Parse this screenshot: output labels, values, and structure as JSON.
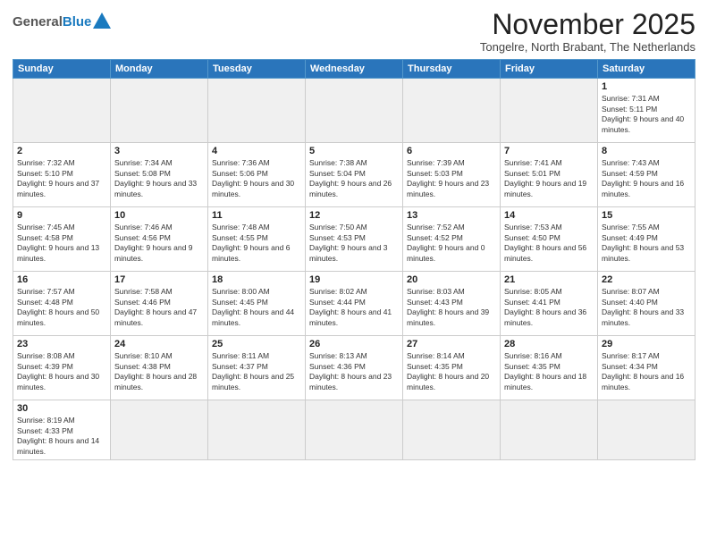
{
  "header": {
    "logo": {
      "general": "General",
      "blue": "Blue"
    },
    "month_year": "November 2025",
    "location": "Tongelre, North Brabant, The Netherlands"
  },
  "weekdays": [
    "Sunday",
    "Monday",
    "Tuesday",
    "Wednesday",
    "Thursday",
    "Friday",
    "Saturday"
  ],
  "weeks": [
    [
      {
        "day": "",
        "empty": true
      },
      {
        "day": "",
        "empty": true
      },
      {
        "day": "",
        "empty": true
      },
      {
        "day": "",
        "empty": true
      },
      {
        "day": "",
        "empty": true
      },
      {
        "day": "",
        "empty": true
      },
      {
        "day": "1",
        "sunrise": "7:31 AM",
        "sunset": "5:11 PM",
        "daylight": "9 hours and 40 minutes."
      }
    ],
    [
      {
        "day": "2",
        "sunrise": "7:32 AM",
        "sunset": "5:10 PM",
        "daylight": "9 hours and 37 minutes."
      },
      {
        "day": "3",
        "sunrise": "7:34 AM",
        "sunset": "5:08 PM",
        "daylight": "9 hours and 33 minutes."
      },
      {
        "day": "4",
        "sunrise": "7:36 AM",
        "sunset": "5:06 PM",
        "daylight": "9 hours and 30 minutes."
      },
      {
        "day": "5",
        "sunrise": "7:38 AM",
        "sunset": "5:04 PM",
        "daylight": "9 hours and 26 minutes."
      },
      {
        "day": "6",
        "sunrise": "7:39 AM",
        "sunset": "5:03 PM",
        "daylight": "9 hours and 23 minutes."
      },
      {
        "day": "7",
        "sunrise": "7:41 AM",
        "sunset": "5:01 PM",
        "daylight": "9 hours and 19 minutes."
      },
      {
        "day": "8",
        "sunrise": "7:43 AM",
        "sunset": "4:59 PM",
        "daylight": "9 hours and 16 minutes."
      }
    ],
    [
      {
        "day": "9",
        "sunrise": "7:45 AM",
        "sunset": "4:58 PM",
        "daylight": "9 hours and 13 minutes."
      },
      {
        "day": "10",
        "sunrise": "7:46 AM",
        "sunset": "4:56 PM",
        "daylight": "9 hours and 9 minutes."
      },
      {
        "day": "11",
        "sunrise": "7:48 AM",
        "sunset": "4:55 PM",
        "daylight": "9 hours and 6 minutes."
      },
      {
        "day": "12",
        "sunrise": "7:50 AM",
        "sunset": "4:53 PM",
        "daylight": "9 hours and 3 minutes."
      },
      {
        "day": "13",
        "sunrise": "7:52 AM",
        "sunset": "4:52 PM",
        "daylight": "9 hours and 0 minutes."
      },
      {
        "day": "14",
        "sunrise": "7:53 AM",
        "sunset": "4:50 PM",
        "daylight": "8 hours and 56 minutes."
      },
      {
        "day": "15",
        "sunrise": "7:55 AM",
        "sunset": "4:49 PM",
        "daylight": "8 hours and 53 minutes."
      }
    ],
    [
      {
        "day": "16",
        "sunrise": "7:57 AM",
        "sunset": "4:48 PM",
        "daylight": "8 hours and 50 minutes."
      },
      {
        "day": "17",
        "sunrise": "7:58 AM",
        "sunset": "4:46 PM",
        "daylight": "8 hours and 47 minutes."
      },
      {
        "day": "18",
        "sunrise": "8:00 AM",
        "sunset": "4:45 PM",
        "daylight": "8 hours and 44 minutes."
      },
      {
        "day": "19",
        "sunrise": "8:02 AM",
        "sunset": "4:44 PM",
        "daylight": "8 hours and 41 minutes."
      },
      {
        "day": "20",
        "sunrise": "8:03 AM",
        "sunset": "4:43 PM",
        "daylight": "8 hours and 39 minutes."
      },
      {
        "day": "21",
        "sunrise": "8:05 AM",
        "sunset": "4:41 PM",
        "daylight": "8 hours and 36 minutes."
      },
      {
        "day": "22",
        "sunrise": "8:07 AM",
        "sunset": "4:40 PM",
        "daylight": "8 hours and 33 minutes."
      }
    ],
    [
      {
        "day": "23",
        "sunrise": "8:08 AM",
        "sunset": "4:39 PM",
        "daylight": "8 hours and 30 minutes."
      },
      {
        "day": "24",
        "sunrise": "8:10 AM",
        "sunset": "4:38 PM",
        "daylight": "8 hours and 28 minutes."
      },
      {
        "day": "25",
        "sunrise": "8:11 AM",
        "sunset": "4:37 PM",
        "daylight": "8 hours and 25 minutes."
      },
      {
        "day": "26",
        "sunrise": "8:13 AM",
        "sunset": "4:36 PM",
        "daylight": "8 hours and 23 minutes."
      },
      {
        "day": "27",
        "sunrise": "8:14 AM",
        "sunset": "4:35 PM",
        "daylight": "8 hours and 20 minutes."
      },
      {
        "day": "28",
        "sunrise": "8:16 AM",
        "sunset": "4:35 PM",
        "daylight": "8 hours and 18 minutes."
      },
      {
        "day": "29",
        "sunrise": "8:17 AM",
        "sunset": "4:34 PM",
        "daylight": "8 hours and 16 minutes."
      }
    ],
    [
      {
        "day": "30",
        "sunrise": "8:19 AM",
        "sunset": "4:33 PM",
        "daylight": "8 hours and 14 minutes."
      },
      {
        "day": "",
        "empty": true
      },
      {
        "day": "",
        "empty": true
      },
      {
        "day": "",
        "empty": true
      },
      {
        "day": "",
        "empty": true
      },
      {
        "day": "",
        "empty": true
      },
      {
        "day": "",
        "empty": true
      }
    ]
  ]
}
